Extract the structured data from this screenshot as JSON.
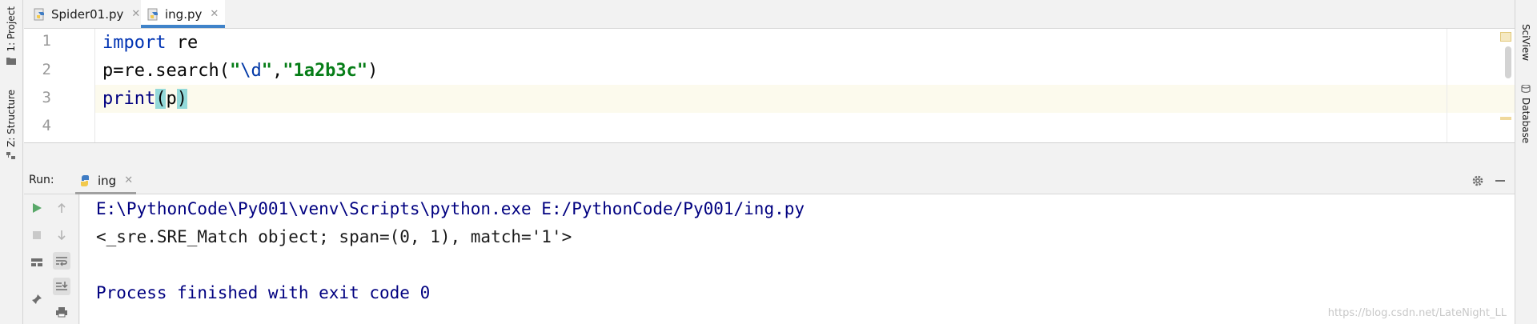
{
  "left_strip": {
    "project_label": "1: Project",
    "structure_label": "Z: Structure"
  },
  "right_strip": {
    "sciview_label": "SciView",
    "database_label": "Database"
  },
  "editor_tabs": [
    {
      "label": "Spider01.py",
      "active": false
    },
    {
      "label": "ing.py",
      "active": true
    }
  ],
  "editor": {
    "line_numbers": [
      "1",
      "2",
      "3",
      "4"
    ],
    "current_line": 3,
    "line1": {
      "keyword": "import",
      "rest": " re"
    },
    "line2": {
      "prefix": "p=re.search(",
      "quote_open": "\"",
      "escape": "\\d",
      "quote_close": "\"",
      "comma": ",",
      "string2": "\"1a2b3c\"",
      "suffix": ")"
    },
    "line3": {
      "func": "print",
      "open": "(",
      "arg": "p",
      "close": ")"
    }
  },
  "run_panel": {
    "label": "Run:",
    "tab_label": "ing",
    "icons": {
      "settings": "gear-icon",
      "minimize": "minimize-icon"
    }
  },
  "console": {
    "command": "E:\\PythonCode\\Py001\\venv\\Scripts\\python.exe E:/PythonCode/Py001/ing.py",
    "output": "<_sre.SRE_Match object; span=(0, 1), match='1'>",
    "exit_message": "Process finished with exit code 0"
  },
  "watermark": "https://blog.csdn.net/LateNight_LL",
  "colors": {
    "keyword": "#0033b3",
    "string": "#067d17",
    "active_tab_underline": "#4083c9",
    "run_green": "#59a869",
    "caret_line": "#fcfaed",
    "brace_highlight": "#93d9d9"
  }
}
